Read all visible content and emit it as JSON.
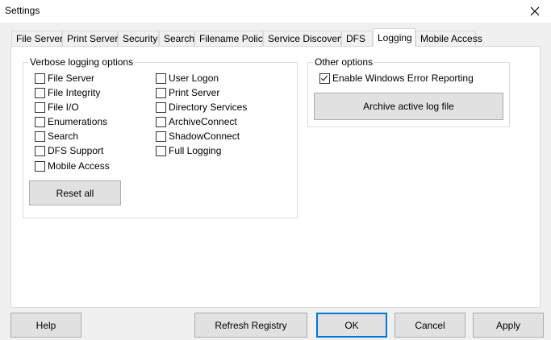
{
  "window": {
    "title": "Settings"
  },
  "tabs": [
    {
      "label": "File Server"
    },
    {
      "label": "Print Server"
    },
    {
      "label": "Security"
    },
    {
      "label": "Search"
    },
    {
      "label": "Filename Policy"
    },
    {
      "label": "Service Discovery"
    },
    {
      "label": "DFS"
    },
    {
      "label": "Logging"
    },
    {
      "label": "Mobile Access"
    }
  ],
  "active_tab": "Logging",
  "verbose": {
    "title": "Verbose logging options",
    "left": [
      {
        "label": "File Server",
        "checked": false
      },
      {
        "label": "File Integrity",
        "checked": false
      },
      {
        "label": "File I/O",
        "checked": false
      },
      {
        "label": "Enumerations",
        "checked": false
      },
      {
        "label": "Search",
        "checked": false
      },
      {
        "label": "DFS Support",
        "checked": false
      },
      {
        "label": "Mobile Access",
        "checked": false
      }
    ],
    "right": [
      {
        "label": "User Logon",
        "checked": false
      },
      {
        "label": "Print Server",
        "checked": false
      },
      {
        "label": "Directory Services",
        "checked": false
      },
      {
        "label": "ArchiveConnect",
        "checked": false
      },
      {
        "label": "ShadowConnect",
        "checked": false
      },
      {
        "label": "Full Logging",
        "checked": false
      }
    ],
    "reset_label": "Reset all"
  },
  "other": {
    "title": "Other options",
    "error_reporting": {
      "label": "Enable Windows Error Reporting",
      "checked": true
    },
    "archive_label": "Archive active log file"
  },
  "footer": {
    "help": "Help",
    "refresh": "Refresh Registry",
    "ok": "OK",
    "cancel": "Cancel",
    "apply": "Apply"
  }
}
